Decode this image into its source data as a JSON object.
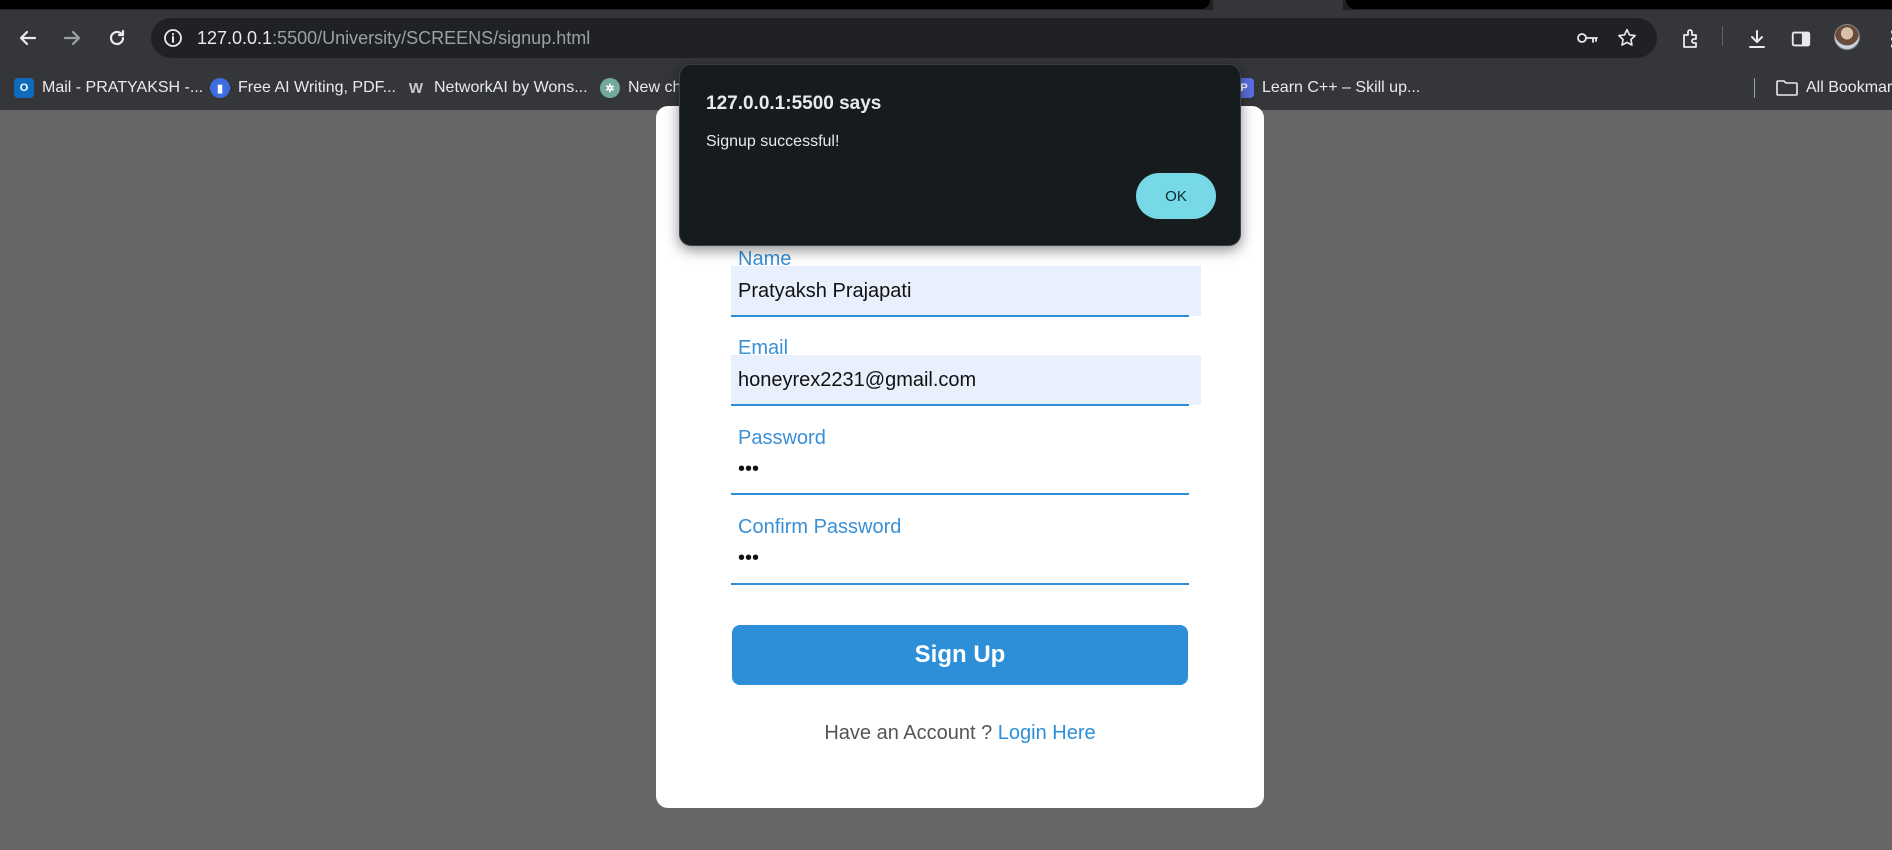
{
  "browser": {
    "url_host": "127.0.0.1",
    "url_rest": ":5500/University/SCREENS/signup.html",
    "bookmarks": [
      {
        "label": "Mail - PRATYAKSH -...",
        "icon": "outlook-icon",
        "color": "#0f6cbd"
      },
      {
        "label": "Free AI Writing, PDF...",
        "icon": "writing-tool-icon",
        "color": "#3b6fe0"
      },
      {
        "label": "NetworkAI by Wons...",
        "icon": "networkai-icon",
        "color": "#35363a"
      },
      {
        "label": "New ch",
        "icon": "chatgpt-icon",
        "color": "#74aa9c"
      },
      {
        "label": "Learn C++ – Skill up...",
        "icon": "cpp-site-icon",
        "color": "#5b6ee1"
      }
    ],
    "all_bookmarks": "All Bookmarks"
  },
  "dialog": {
    "title": "127.0.0.1:5500 says",
    "message": "Signup successful!",
    "ok_label": "OK",
    "ok_color": "#78d9e6"
  },
  "form": {
    "name_label": "Name",
    "name_value": "Pratyaksh Prajapati",
    "email_label": "Email",
    "email_value": "honeyrex2231@gmail.com",
    "password_label": "Password",
    "password_value": "abc",
    "confirm_label": "Confirm Password",
    "confirm_value": "abc",
    "submit_label": "Sign Up",
    "accent_color": "#2c8fd8"
  },
  "footer": {
    "prompt": "Have an Account ? ",
    "link": "Login Here"
  }
}
